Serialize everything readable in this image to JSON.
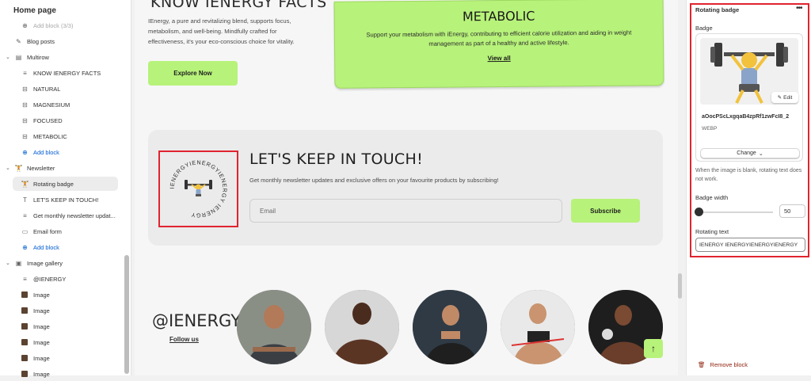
{
  "sidebar": {
    "title": "Home page",
    "items": [
      {
        "label": "Add block (3/3)",
        "icon": "plus-circle-icon"
      },
      {
        "label": "Blog posts",
        "icon": "blog-icon"
      },
      {
        "label": "Multirow",
        "icon": "section-icon"
      },
      {
        "label": "KNOW IENERGY FACTS",
        "icon": "text-block-icon"
      },
      {
        "label": "NATURAL",
        "icon": "row-block-icon"
      },
      {
        "label": "MAGNESIUM",
        "icon": "row-block-icon"
      },
      {
        "label": "FOCUSED",
        "icon": "row-block-icon"
      },
      {
        "label": "METABOLIC",
        "icon": "row-block-icon"
      },
      {
        "label": "Add block",
        "icon": "plus-circle-icon"
      },
      {
        "label": "Newsletter",
        "icon": "emoji-icon"
      },
      {
        "label": "Rotating badge",
        "icon": "emoji-icon"
      },
      {
        "label": "LET'S KEEP IN TOUCH!",
        "icon": "heading-icon"
      },
      {
        "label": "Get monthly newsletter updat...",
        "icon": "text-block-icon"
      },
      {
        "label": "Email form",
        "icon": "form-icon"
      },
      {
        "label": "Add block",
        "icon": "plus-circle-icon"
      },
      {
        "label": "Image gallery",
        "icon": "gallery-icon"
      },
      {
        "label": "@IENERGY",
        "icon": "text-block-icon"
      },
      {
        "label": "Image",
        "icon": "image-icon"
      },
      {
        "label": "Image",
        "icon": "image-icon"
      },
      {
        "label": "Image",
        "icon": "image-icon"
      },
      {
        "label": "Image",
        "icon": "image-icon"
      },
      {
        "label": "Image",
        "icon": "image-icon"
      },
      {
        "label": "Image",
        "icon": "image-icon"
      }
    ]
  },
  "preview": {
    "know_title": "KNOW IENERGY FACTS",
    "know_text": "IEnergy, a pure and revitalizing blend, supports focus, metabolism, and well-being. Mindfully crafted for effectiveness, it's your eco-conscious choice for vitality.",
    "explore_label": "Explore Now",
    "metabolic_title": "METABOLIC",
    "metabolic_text": "Support your metabolism with iEnergy, contributing to efficient calorie utilization and aiding in weight management as part of a healthy and active lifestyle.",
    "metabolic_link": "View all",
    "rotating_text": "IENERGYIENERGYIENERGY IENERGY",
    "newsletter_title": "LET'S KEEP IN TOUCH!",
    "newsletter_sub": "Get monthly newsletter updates and exclusive offers on your favourite products by subscribing!",
    "email_placeholder": "Email",
    "subscribe_label": "Subscribe",
    "gallery_handle": "@IENERGY",
    "follow_label": "Follow us",
    "scroll_top_icon": "arrow-up-icon",
    "accent_color": "#b7f27a"
  },
  "panel": {
    "title": "Rotating badge",
    "badge_label": "Badge",
    "edit_label": "Edit",
    "file_name": "aOocPScLxgqaB4zpRf1zwFcI8_2",
    "file_type": "WEBP",
    "change_label": "Change",
    "help_text": "When the image is blank, rotating text does not work.",
    "width_label": "Badge width",
    "width_value": "50",
    "rotating_label": "Rotating text",
    "rotating_value": "IENERGY IENERGYIENERGYIENERGY",
    "remove_label": "Remove block",
    "highlight_color": "#e0242e"
  }
}
